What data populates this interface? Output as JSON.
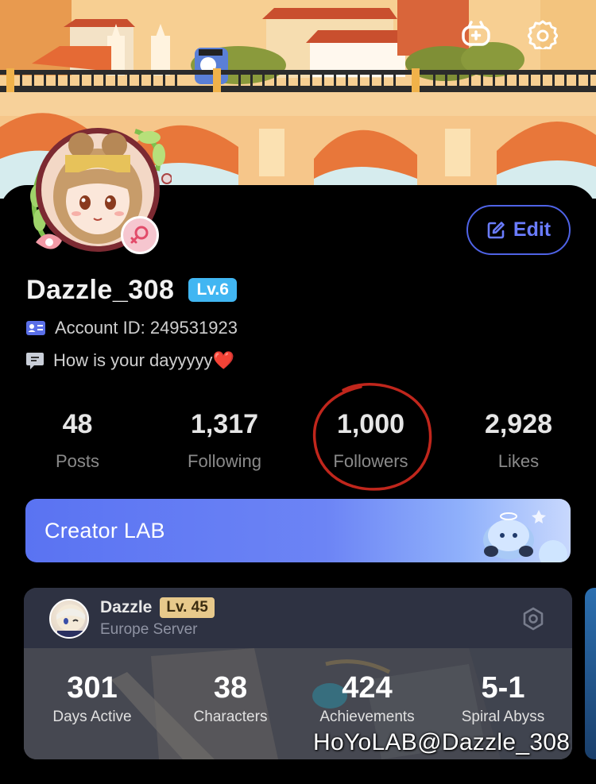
{
  "header": {
    "icons": [
      "gamepad-icon",
      "gear-icon"
    ]
  },
  "profile": {
    "username": "Dazzle_308",
    "level": "Lv.6",
    "account_id": "Account ID: 249531923",
    "bio": "How is your dayyyyy",
    "bio_emoji": "❤️",
    "edit_label": "Edit"
  },
  "stats": [
    {
      "value": "48",
      "label": "Posts"
    },
    {
      "value": "1,317",
      "label": "Following"
    },
    {
      "value": "1,000",
      "label": "Followers"
    },
    {
      "value": "2,928",
      "label": "Likes"
    }
  ],
  "creator": {
    "label": "Creator LAB"
  },
  "game_card": {
    "name": "Dazzle",
    "level": "Lv. 45",
    "server": "Europe Server",
    "stats": [
      {
        "value": "301",
        "label": "Days Active"
      },
      {
        "value": "38",
        "label": "Characters"
      },
      {
        "value": "424",
        "label": "Achievements"
      },
      {
        "value": "5-1",
        "label": "Spiral Abyss"
      }
    ]
  },
  "watermark": "HoYoLAB@Dazzle_308",
  "colors": {
    "accent": "#4f63e6",
    "level_badge": "#41b6f2",
    "game_level_badge": "#e7c98b",
    "annotation_circle": "#c0261c"
  }
}
